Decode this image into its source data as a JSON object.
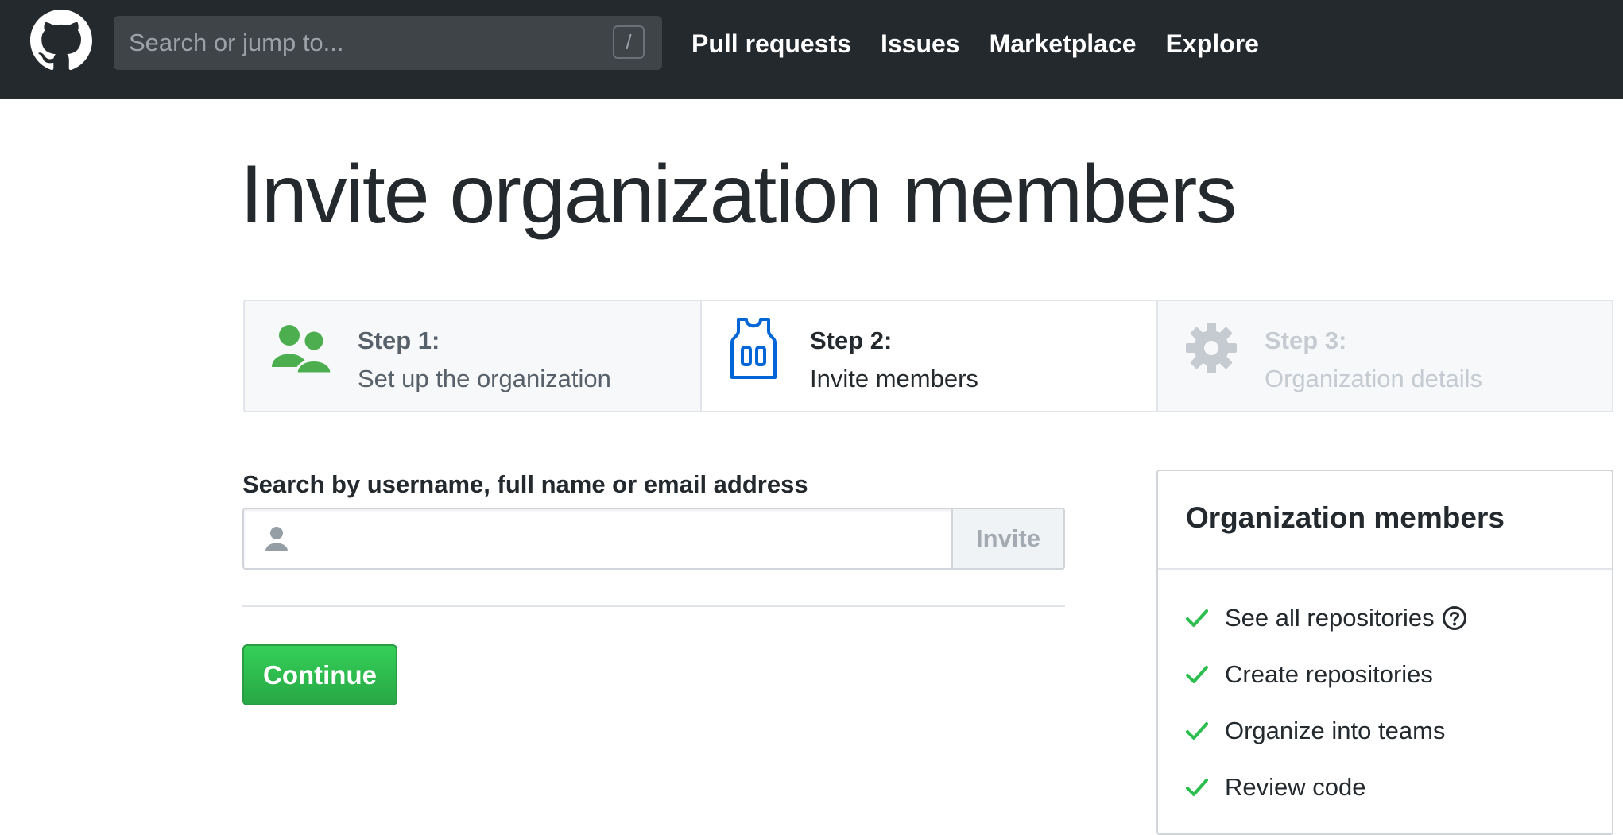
{
  "header": {
    "search_placeholder": "Search or jump to...",
    "slash_hint": "/",
    "nav": [
      "Pull requests",
      "Issues",
      "Marketplace",
      "Explore"
    ]
  },
  "page": {
    "title": "Invite organization members"
  },
  "steps": [
    {
      "number": "Step 1:",
      "description": "Set up the organization",
      "state": "complete",
      "icon": "people-icon"
    },
    {
      "number": "Step 2:",
      "description": "Invite members",
      "state": "current",
      "icon": "jersey-icon"
    },
    {
      "number": "Step 3:",
      "description": "Organization details",
      "state": "upcoming",
      "icon": "gear-icon"
    }
  ],
  "form": {
    "label": "Search by username, full name or email address",
    "input_value": "",
    "invite_label": "Invite",
    "continue_label": "Continue"
  },
  "members_box": {
    "title": "Organization members",
    "permissions": [
      "See all repositories",
      "Create repositories",
      "Organize into teams",
      "Review code"
    ]
  },
  "colors": {
    "header_bg": "#24292e",
    "success_green": "#28a745",
    "check_green": "#2cbe4e",
    "accent_blue": "#0366d6"
  }
}
